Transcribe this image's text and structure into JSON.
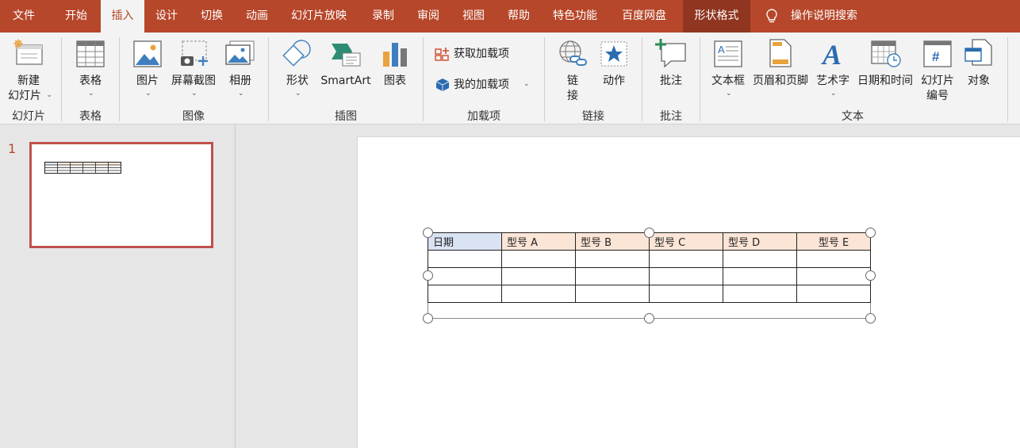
{
  "tabs": [
    {
      "label": "文件",
      "state": "normal"
    },
    {
      "label": "开始",
      "state": "normal"
    },
    {
      "label": "插入",
      "state": "active"
    },
    {
      "label": "设计",
      "state": "normal"
    },
    {
      "label": "切换",
      "state": "normal"
    },
    {
      "label": "动画",
      "state": "normal"
    },
    {
      "label": "幻灯片放映",
      "state": "normal"
    },
    {
      "label": "录制",
      "state": "normal"
    },
    {
      "label": "审阅",
      "state": "normal"
    },
    {
      "label": "视图",
      "state": "normal"
    },
    {
      "label": "帮助",
      "state": "normal"
    },
    {
      "label": "特色功能",
      "state": "normal"
    },
    {
      "label": "百度网盘",
      "state": "normal"
    },
    {
      "label": "形状格式",
      "state": "context"
    }
  ],
  "tell_me": {
    "label": "操作说明搜索",
    "icon": "lightbulb-icon"
  },
  "ribbon": {
    "groups": {
      "slides": "幻灯片",
      "tables": "表格",
      "images": "图像",
      "illustrations": "插图",
      "addins": "加载项",
      "links": "链接",
      "comments": "批注",
      "text": "文本"
    },
    "buttons": {
      "new_slide_line1": "新建",
      "new_slide_line2": "幻灯片",
      "table": "表格",
      "picture": "图片",
      "screenshot": "屏幕截图",
      "album": "相册",
      "shapes": "形状",
      "smartart": "SmartArt",
      "chart": "图表",
      "get_addins": "获取加载项",
      "my_addins": "我的加载项",
      "link_line1": "链",
      "link_line2": "接",
      "action": "动作",
      "comment": "批注",
      "textbox": "文本框",
      "header_footer": "页眉和页脚",
      "wordart": "艺术字",
      "datetime": "日期和时间",
      "slide_number_line1": "幻灯片",
      "slide_number_line2": "编号",
      "object": "对象"
    }
  },
  "thumbnails": [
    {
      "number": "1"
    }
  ],
  "slide_table": {
    "header": [
      "日期",
      "型号 A",
      "型号 B",
      "型号 C",
      "型号 D",
      "型号 E"
    ],
    "empty_rows": 3
  },
  "colors": {
    "accent": "#b7472a",
    "context_tab": "#8f3520",
    "header_date_fill": "#dae3f3",
    "header_model_fill": "#fbe5d6",
    "thumb_border": "#c0504d"
  }
}
